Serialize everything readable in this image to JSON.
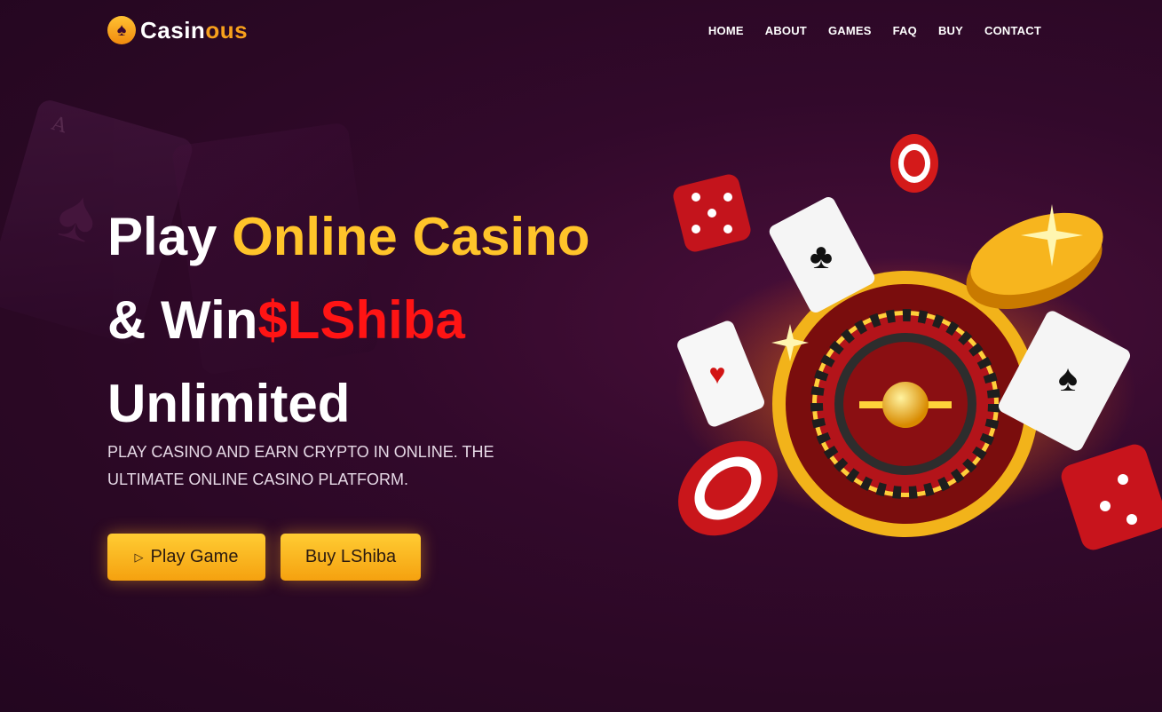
{
  "brand": {
    "name_part1": "Casin",
    "name_part2": "ous",
    "logo_icon": "spade-icon"
  },
  "nav": {
    "items": [
      {
        "label": "HOME"
      },
      {
        "label": "ABOUT"
      },
      {
        "label": "GAMES"
      },
      {
        "label": "FAQ"
      },
      {
        "label": "BUY"
      },
      {
        "label": "CONTACT"
      }
    ]
  },
  "hero": {
    "title_part1": "Play ",
    "title_highlight": "Online Casino",
    "title_part2": "& Win",
    "title_red": "$LShiba",
    "title_part3": "Unlimited",
    "subtitle": "PLAY CASINO AND EARN CRYPTO IN ONLINE. THE ULTIMATE ONLINE CASINO PLATFORM.",
    "play_button": "Play Game",
    "play_icon": "play-triangle-icon",
    "buy_button": "Buy LShiba"
  },
  "colors": {
    "background": "#2a0824",
    "gold": "#ffc42a",
    "red": "#ff1414",
    "button": "#f5a10f"
  }
}
